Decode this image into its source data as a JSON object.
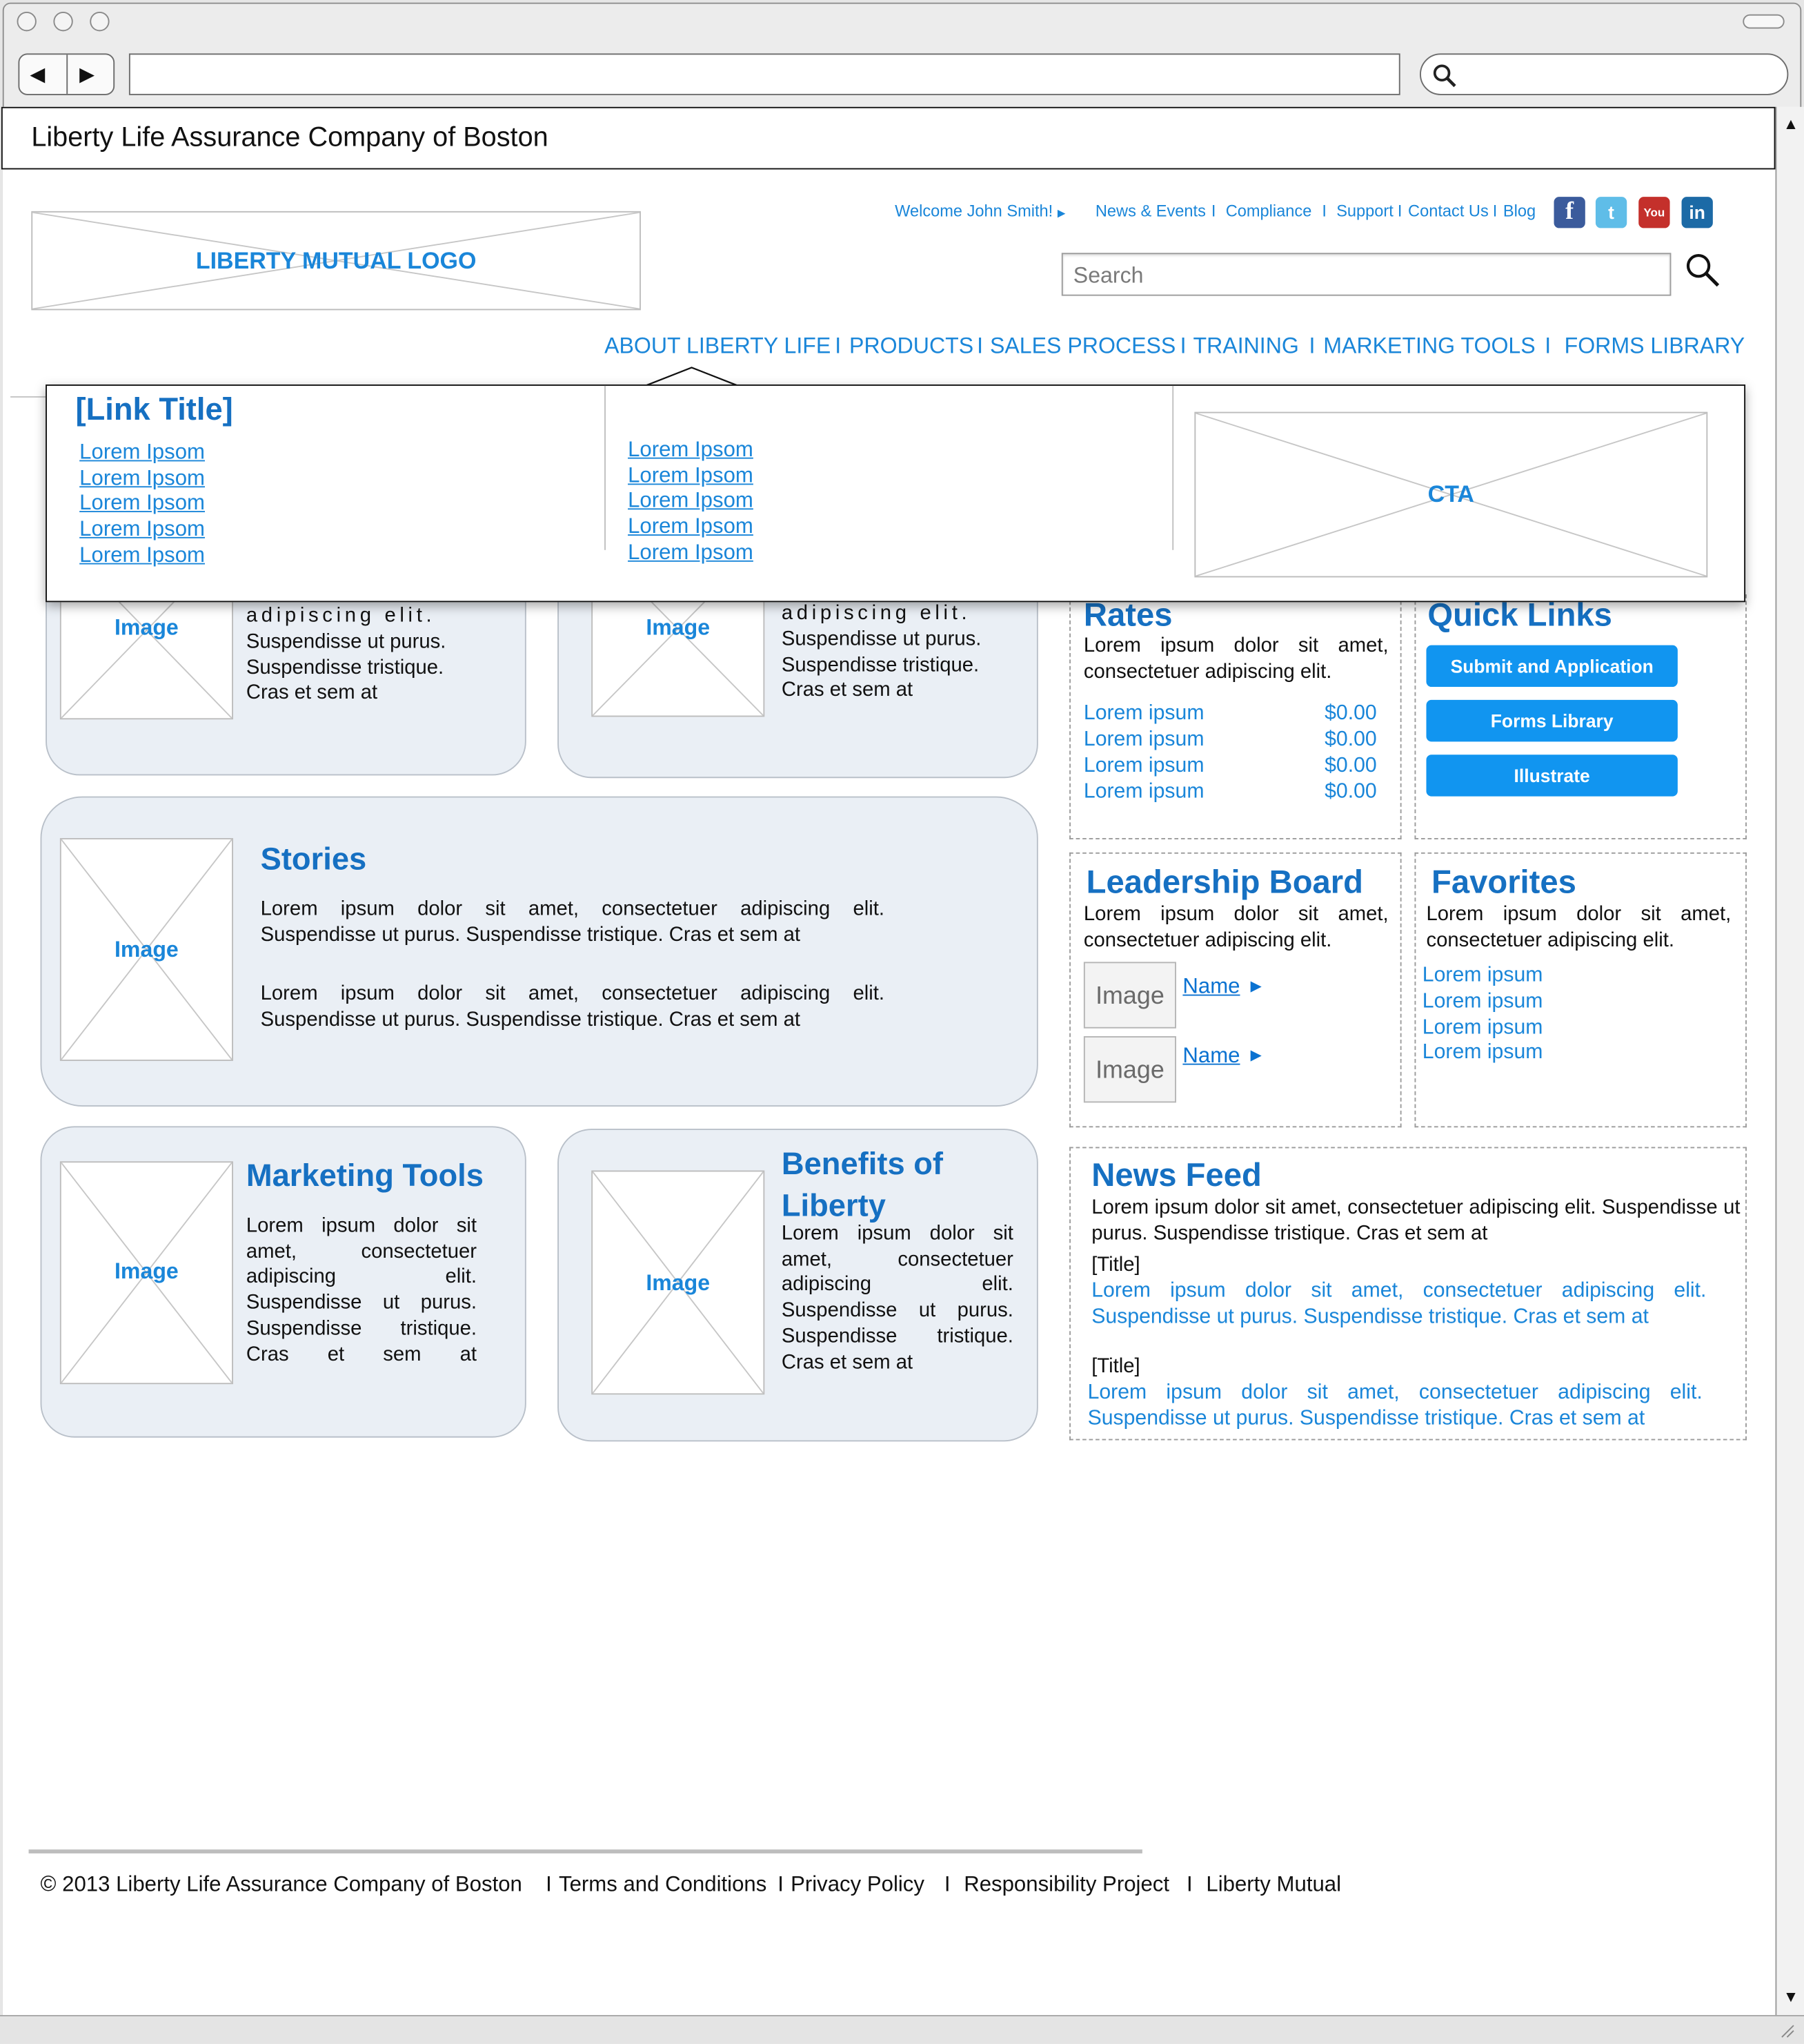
{
  "browser": {
    "tab_title": "Liberty Life Assurance Company of Boston",
    "back_glyph": "◀",
    "forward_glyph": "▶",
    "scroll_up": "▲",
    "scroll_down": "▼"
  },
  "header": {
    "logo_label": "LIBERTY MUTUAL LOGO",
    "welcome": "Welcome John Smith!",
    "links": [
      "News & Events",
      "Compliance",
      "Support",
      "Contact Us",
      "Blog"
    ],
    "search_placeholder": "Search",
    "social": {
      "facebook": "f",
      "twitter": "t",
      "youtube": "You",
      "linkedin": "in"
    }
  },
  "main_nav": [
    "ABOUT LIBERTY LIFE",
    "PRODUCTS",
    "SALES PROCESS",
    "TRAINING",
    "MARKETING TOOLS",
    "FORMS LIBRARY"
  ],
  "mega_menu": {
    "title": "[Link Title]",
    "col1": [
      "Lorem Ipsom",
      "Lorem Ipsom",
      "Lorem Ipsom",
      "Lorem Ipsom",
      "Lorem Ipsom"
    ],
    "col2": [
      "Lorem Ipsom",
      "Lorem Ipsom",
      "Lorem Ipsom",
      "Lorem Ipsom",
      "Lorem Ipsom"
    ],
    "cta": "CTA"
  },
  "cards": {
    "image_label": "Image",
    "top_left_text": [
      "adipiscing elit.",
      "Suspendisse ut purus.",
      "Suspendisse tristique.",
      "Cras et sem at"
    ],
    "top_right_text": [
      "adipiscing elit.",
      "Suspendisse ut purus.",
      "Suspendisse tristique.",
      "Cras et sem at"
    ],
    "stories": {
      "title": "Stories",
      "p1": "Lorem ipsum dolor sit amet, consectetuer adipiscing elit. Suspendisse ut purus. Suspendisse tristique. Cras et sem at",
      "p2": "Lorem ipsum dolor sit amet, consectetuer adipiscing elit. Suspendisse ut purus. Suspendisse tristique. Cras et sem at"
    },
    "marketing": {
      "title": "Marketing Tools",
      "text": "Lorem ipsum dolor sit amet, consectetuer adipiscing elit. Suspendisse ut purus. Suspendisse tristique. Cras et sem at"
    },
    "benefits": {
      "title": "Benefits of Liberty",
      "text": "Lorem ipsum dolor sit amet, consectetuer adipiscing elit. Suspendisse ut purus. Suspendisse tristique. Cras et sem at"
    }
  },
  "rates": {
    "title": "Rates",
    "text": "Lorem ipsum dolor sit amet, consectetuer adipiscing elit.",
    "rows": [
      {
        "label": "Lorem ipsum",
        "value": "$0.00"
      },
      {
        "label": "Lorem ipsum",
        "value": "$0.00"
      },
      {
        "label": "Lorem ipsum",
        "value": "$0.00"
      },
      {
        "label": "Lorem ipsum",
        "value": "$0.00"
      }
    ]
  },
  "quick_links": {
    "title": "Quick Links",
    "buttons": [
      "Submit and Application",
      "Forms Library",
      "Illustrate"
    ]
  },
  "leadership": {
    "title": "Leadership Board",
    "text": "Lorem ipsum dolor sit amet, consectetuer adipiscing elit.",
    "image_label": "Image",
    "names": [
      "Name",
      "Name"
    ]
  },
  "favorites": {
    "title": "Favorites",
    "text": "Lorem ipsum dolor sit amet, consectetuer adipiscing elit.",
    "links": [
      "Lorem ipsum",
      "Lorem ipsum",
      "Lorem ipsum",
      "Lorem ipsum"
    ]
  },
  "news_feed": {
    "title": "News Feed",
    "intro": "Lorem ipsum dolor sit amet, consectetuer adipiscing elit. Suspendisse ut purus. Suspendisse tristique. Cras et sem at",
    "items": [
      {
        "title": "[Title]",
        "text": "Lorem ipsum dolor sit amet, consectetuer adipiscing elit. Suspendisse ut purus. Suspendisse tristique. Cras et sem at"
      },
      {
        "title": "[Title]",
        "text": "Lorem ipsum dolor sit amet, consectetuer adipiscing elit. Suspendisse ut purus. Suspendisse tristique. Cras et sem at"
      }
    ]
  },
  "footer": {
    "copyright": "© 2013 Liberty Life Assurance Company of Boston",
    "links": [
      "Terms and Conditions",
      "Privacy Policy",
      "Responsibility Project",
      "Liberty Mutual"
    ]
  },
  "colors": {
    "link_blue": "#1a86d9",
    "heading_blue": "#1670c2",
    "button_blue": "#1195f0",
    "card_bg": "#eaeff5"
  }
}
